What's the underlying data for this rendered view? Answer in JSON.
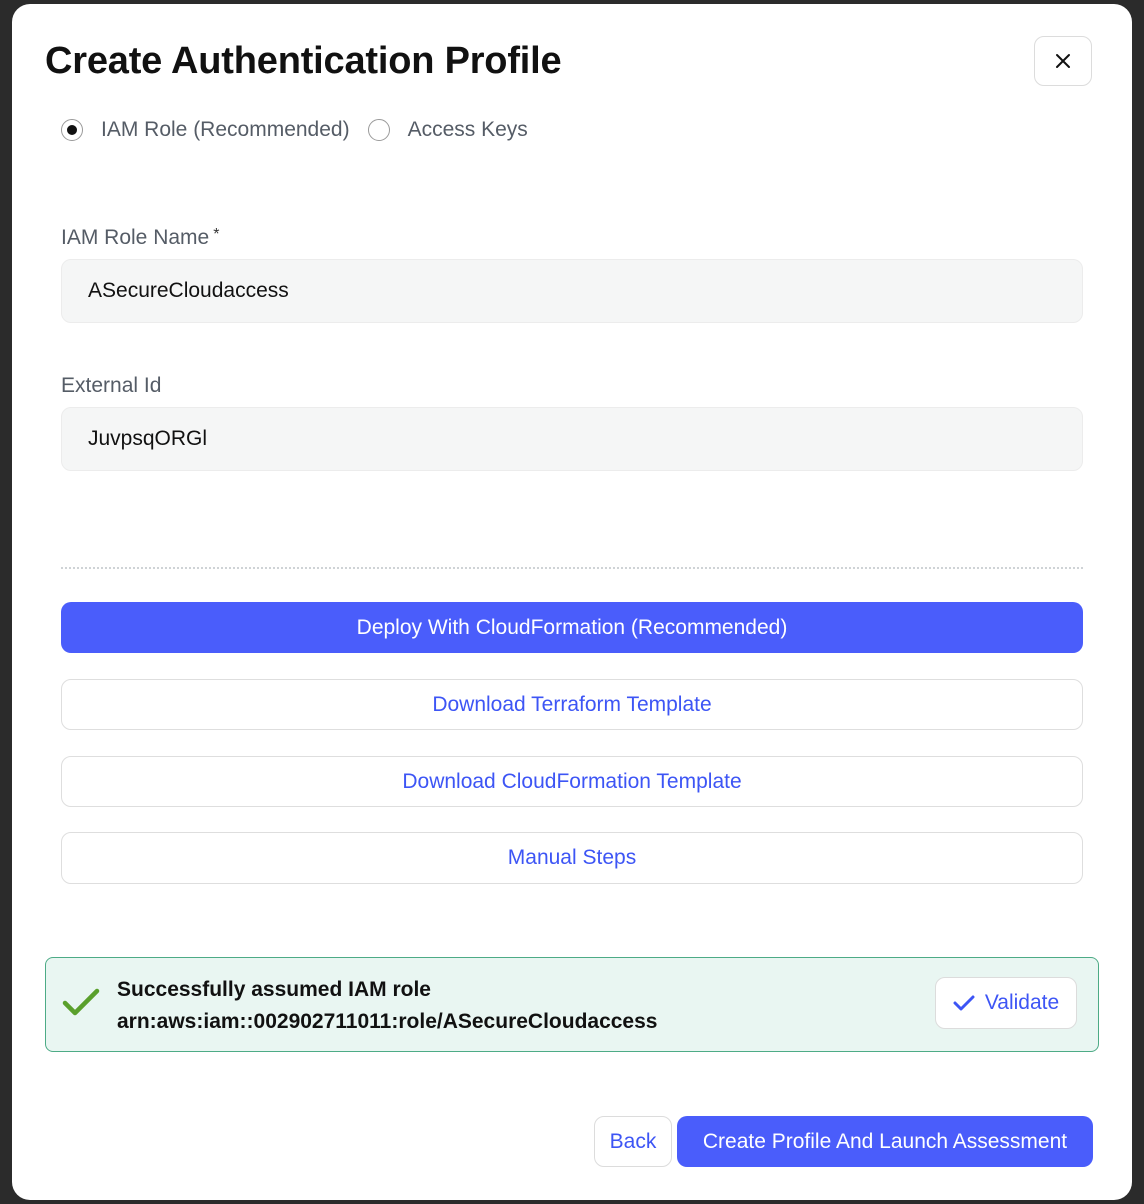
{
  "modal": {
    "title": "Create Authentication Profile",
    "close_icon": "close-icon"
  },
  "auth_method": {
    "options": [
      {
        "label": "IAM Role (Recommended)",
        "selected": true
      },
      {
        "label": "Access Keys",
        "selected": false
      }
    ]
  },
  "fields": {
    "role_name": {
      "label": "IAM Role Name",
      "required_mark": "*",
      "value": "ASecureCloudaccess"
    },
    "external_id": {
      "label": "External Id",
      "value": "JuvpsqORGl"
    }
  },
  "actions": {
    "deploy_cloudformation": "Deploy With CloudFormation (Recommended)",
    "download_terraform": "Download Terraform Template",
    "download_cloudformation": "Download CloudFormation Template",
    "manual_steps": "Manual Steps"
  },
  "status": {
    "icon": "checkmark-icon",
    "line1": "Successfully assumed IAM role",
    "line2": "arn:aws:iam::002902711011:role/ASecureCloudaccess",
    "validate_label": "Validate",
    "color": "#4dab86"
  },
  "footer": {
    "back_label": "Back",
    "create_label": "Create Profile And Launch Assessment"
  },
  "colors": {
    "primary": "#4a5dfb",
    "link": "#3d55f5",
    "success_bg": "#e9f6f2",
    "check": "#5aa02c"
  }
}
